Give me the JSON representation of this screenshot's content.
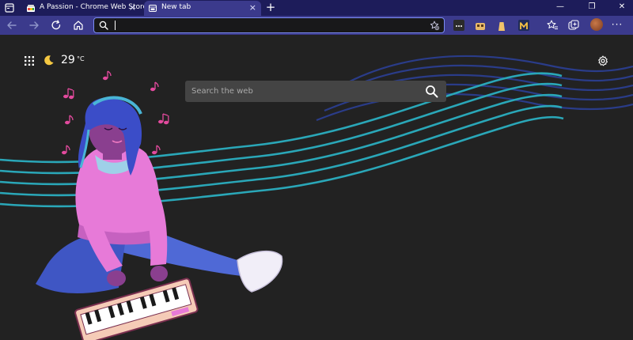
{
  "tabs": [
    {
      "title": "A Passion - Chrome Web Store",
      "active": false
    },
    {
      "title": "New tab",
      "active": true
    }
  ],
  "tab_close_glyph": "×",
  "new_tab_glyph": "+",
  "window_controls": {
    "minimize": "—",
    "restore": "❐",
    "close": "✕"
  },
  "address_bar": {
    "value": "",
    "placeholder": ""
  },
  "toolbar_more_glyph": "···",
  "weather": {
    "temperature": "29",
    "unit": "°C",
    "condition_icon": "moon-icon"
  },
  "search": {
    "placeholder": "Search the web",
    "value": ""
  },
  "icons": {
    "tab_actions": "tab-actions-icon",
    "back": "back-arrow-icon",
    "forward": "forward-arrow-icon",
    "refresh": "refresh-icon",
    "home": "home-icon",
    "address_search": "search-icon",
    "add_favorite": "add-favorite-icon",
    "favorites": "favorites-icon",
    "collections": "collections-icon",
    "apps": "apps-grid-icon",
    "settings": "gear-icon",
    "search_button": "search-icon"
  },
  "colors": {
    "tabstrip": "#1d1c5a",
    "toolbar": "#3b3a8c",
    "address_focus": "#7b8cf2",
    "page_bg": "#222222",
    "search_box": "#444444",
    "music_notes": "#e34a9e",
    "staff_lines_teal": "#2aa7b8",
    "staff_lines_blue": "#2b3f95"
  },
  "background_art": "illustration of a girl with blue locs and headphones sitting with a keyboard synth, music notes and wavy staff lines"
}
